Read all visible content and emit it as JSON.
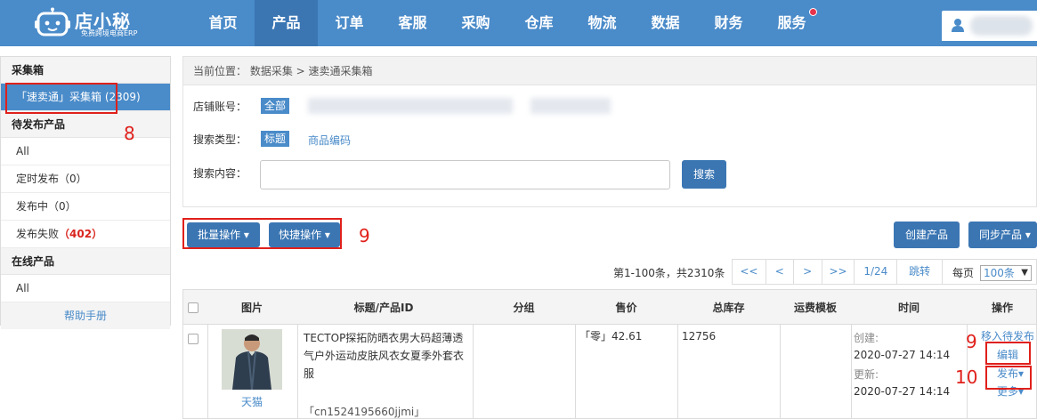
{
  "logo": {
    "name": "店小秘",
    "slogan": "免费跨境电商ERP"
  },
  "nav": [
    {
      "label": "首页"
    },
    {
      "label": "产品"
    },
    {
      "label": "订单"
    },
    {
      "label": "客服"
    },
    {
      "label": "采购"
    },
    {
      "label": "仓库"
    },
    {
      "label": "物流"
    },
    {
      "label": "数据"
    },
    {
      "label": "财务"
    },
    {
      "label": "服务"
    }
  ],
  "sidebar": {
    "collect_head": "采集箱",
    "collect_item": "「速卖通」采集箱 (2309)",
    "pending_head": "待发布产品",
    "pending_all": "All",
    "scheduled_label": "定时发布",
    "scheduled_count": "（0）",
    "publishing_label": "发布中",
    "publishing_count": "（0）",
    "failed_label": "发布失败",
    "failed_count": "（402）",
    "online_head": "在线产品",
    "online_all": "All",
    "help": "帮助手册"
  },
  "breadcrumb": "当前位置：  数据采集 > 速卖通采集箱",
  "filter": {
    "store_label": "店铺账号：",
    "store_all": "全部",
    "type_label": "搜索类型：",
    "type_title": "标题",
    "type_code": "商品编码",
    "content_label": "搜索内容：",
    "search_button": "搜索",
    "search_value": ""
  },
  "toolbar": {
    "batch": "批量操作",
    "quick": "快捷操作",
    "create": "创建产品",
    "sync": "同步产品"
  },
  "pager": {
    "summary": "第1-100条，共2310条",
    "first": "<<",
    "prev": "<",
    "next": ">",
    "last": ">>",
    "page": "1/24",
    "jump": "跳转",
    "per_page_label": "每页",
    "per_page_value": "100条"
  },
  "table": {
    "headers": {
      "image": "图片",
      "title": "标题/产品ID",
      "group": "分组",
      "price": "售价",
      "stock": "总库存",
      "shipping": "运费模板",
      "time": "时间",
      "action": "操作"
    },
    "row": {
      "source": "天猫",
      "title": "TECTOP探拓防晒衣男大码超薄透气户外运动皮肤风衣女夏季外套衣服",
      "product_id": "「cn1524195660jjmi」",
      "price": "「零」42.61",
      "stock": "12756",
      "created_label": "创建:",
      "created_time": "2020-07-27 14:14",
      "updated_label": "更新:",
      "updated_time": "2020-07-27 14:14",
      "action_move": "移入待发布",
      "action_edit": "编辑",
      "action_publish": "发布",
      "action_more": "更多"
    }
  },
  "annotations": {
    "a8": "8",
    "a9_toolbar": "9",
    "a9_row": "9",
    "a10": "10"
  },
  "colors": {
    "brand": "#4a8bc9",
    "brand_dark": "#3b76b3",
    "alert": "#e0201b"
  }
}
